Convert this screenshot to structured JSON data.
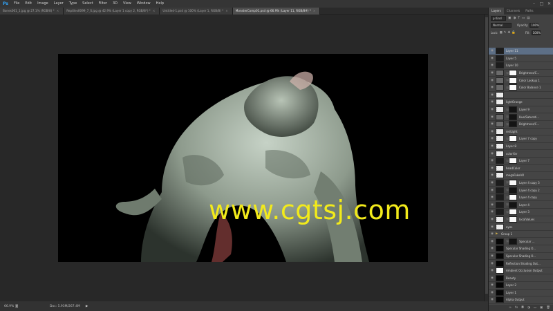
{
  "app": {
    "logo": "Ps"
  },
  "menu": [
    "File",
    "Edit",
    "Image",
    "Layer",
    "Type",
    "Select",
    "Filter",
    "3D",
    "View",
    "Window",
    "Help"
  ],
  "window_controls": [
    "–",
    "□",
    "✕"
  ],
  "tabs": [
    {
      "label": "Bones001_1.jpg @ 27.1% (RGB/8) *",
      "active": false
    },
    {
      "label": "Reptiles0099_7_S.jpg @ 42.9% (Layer 1 copy 2, RGB/8*) *",
      "active": false
    },
    {
      "label": "Untitled-1.psd @ 100% (Layer 1, RGB/8) *",
      "active": false
    },
    {
      "label": "MonsterComp01.psd @ 66.9% (Layer 11, RGB/8#) *",
      "active": true
    }
  ],
  "canvas": {
    "watermark": "www.cgtsj.com"
  },
  "status": {
    "zoom": "66.9%",
    "doc": "Doc: 5.93M/267.4M",
    "arrow": "▶"
  },
  "panel": {
    "tabs": [
      "Layers",
      "Channels",
      "Paths"
    ],
    "kind_label": "ρ Kind",
    "blend_mode": "Normal",
    "opacity_label": "Opacity:",
    "opacity_value": "100%",
    "lock_label": "Lock:",
    "fill_label": "Fill:",
    "fill_value": "100%"
  },
  "layers": [
    {
      "name": "Layer 11",
      "thumb": "photo",
      "mask": "",
      "selected": true
    },
    {
      "name": "Layer 5",
      "thumb": "photo",
      "mask": "",
      "selected": false
    },
    {
      "name": "Layer 10",
      "thumb": "photo",
      "mask": "",
      "selected": false
    },
    {
      "name": "Brightness/C...",
      "thumb": "adj",
      "mask": "white",
      "selected": false
    },
    {
      "name": "Color Lookup 1",
      "thumb": "adj",
      "mask": "white",
      "selected": false
    },
    {
      "name": "Color Balance 1",
      "thumb": "adj",
      "mask": "white",
      "selected": false
    },
    {
      "name": "",
      "thumb": "trans",
      "mask": "",
      "selected": false
    },
    {
      "name": "lightOrange",
      "thumb": "trans",
      "mask": "",
      "selected": false
    },
    {
      "name": "Layer 9",
      "thumb": "trans",
      "mask": "black",
      "selected": false
    },
    {
      "name": "Hue/Saturati...",
      "thumb": "adj",
      "mask": "black",
      "selected": false
    },
    {
      "name": "Brightness/C...",
      "thumb": "adj",
      "mask": "black",
      "selected": false
    },
    {
      "name": "redLight",
      "thumb": "trans",
      "mask": "",
      "selected": false
    },
    {
      "name": "Layer 7 copy",
      "thumb": "trans",
      "mask": "white",
      "selected": false
    },
    {
      "name": "Layer 8",
      "thumb": "trans",
      "mask": "",
      "selected": false
    },
    {
      "name": "colorVar",
      "thumb": "trans",
      "mask": "",
      "selected": false
    },
    {
      "name": "Layer 7",
      "thumb": "photo",
      "mask": "white",
      "selected": false
    },
    {
      "name": "headColor",
      "thumb": "trans",
      "mask": "",
      "selected": false
    },
    {
      "name": "megaFakeAO",
      "thumb": "trans",
      "mask": "",
      "selected": false
    },
    {
      "name": "Layer 4 copy 3",
      "thumb": "photo",
      "mask": "white",
      "selected": false
    },
    {
      "name": "Layer 4 copy 2",
      "thumb": "photo",
      "mask": "black",
      "selected": false
    },
    {
      "name": "Layer 4 copy",
      "thumb": "photo",
      "mask": "white",
      "selected": false
    },
    {
      "name": "Layer 4",
      "thumb": "photo",
      "mask": "black",
      "selected": false
    },
    {
      "name": "Layer 3",
      "thumb": "photo",
      "mask": "white",
      "selected": false
    },
    {
      "name": "localValues",
      "thumb": "trans",
      "mask": "white",
      "selected": false
    },
    {
      "name": "eyes",
      "thumb": "trans",
      "mask": "",
      "selected": false
    },
    {
      "name": "Group 1",
      "thumb": "folder",
      "mask": "",
      "selected": false
    },
    {
      "name": "Specular ...",
      "thumb": "dark",
      "mask": "black",
      "selected": false
    },
    {
      "name": "Specular Shading O...",
      "thumb": "dark",
      "mask": "",
      "selected": false
    },
    {
      "name": "Specular Shading O...",
      "thumb": "dark",
      "mask": "",
      "selected": false
    },
    {
      "name": "Reflection Shading Out...",
      "thumb": "dark",
      "mask": "",
      "selected": false
    },
    {
      "name": "Ambient Occlusion Output",
      "thumb": "white",
      "mask": "",
      "selected": false
    },
    {
      "name": "Beauty",
      "thumb": "dark",
      "mask": "",
      "selected": false
    },
    {
      "name": "Layer 2",
      "thumb": "dark",
      "mask": "",
      "selected": false
    },
    {
      "name": "Layer 1",
      "thumb": "dark",
      "mask": "",
      "selected": false
    },
    {
      "name": "Alpha Output",
      "thumb": "dark",
      "mask": "",
      "selected": false
    }
  ],
  "panel_bottom_icons": [
    "∞",
    "fx",
    "◘",
    "◑",
    "▭",
    "▣",
    "🗑"
  ]
}
